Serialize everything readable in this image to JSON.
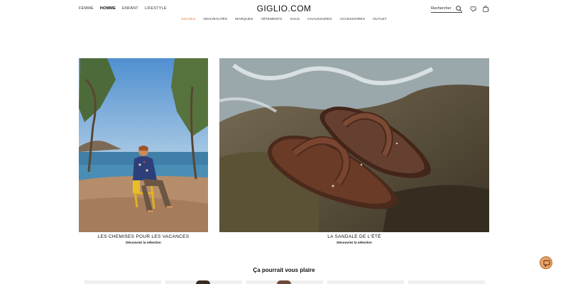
{
  "header": {
    "gender_nav": [
      {
        "label": "FEMME",
        "active": false
      },
      {
        "label": "HOMME",
        "active": true
      },
      {
        "label": "ENFANT",
        "active": false
      },
      {
        "label": "LIFESTYLE",
        "active": false
      }
    ],
    "logo": "GIGLIO.COM",
    "search_label": "Rechercher",
    "wishlist_count": "0",
    "bag_count": "0"
  },
  "category_nav": [
    {
      "label": "SOLDES",
      "highlight": true
    },
    {
      "label": "NOUVEAUTÉS",
      "highlight": false
    },
    {
      "label": "MARQUES",
      "highlight": false
    },
    {
      "label": "VÊTEMENTS",
      "highlight": false
    },
    {
      "label": "SACS",
      "highlight": false
    },
    {
      "label": "CHAUSSURES",
      "highlight": false
    },
    {
      "label": "ACCESSOIRES",
      "highlight": false
    },
    {
      "label": "OUTLET",
      "highlight": false
    }
  ],
  "hero": {
    "left": {
      "title": "LES CHEMISES POUR LES VACANCES",
      "cta": "Découvrez la sélection"
    },
    "right": {
      "title": "LA SANDALE DE L'ÉTÉ",
      "cta": "Découvrez la sélection"
    }
  },
  "recommendations": {
    "title": "Ça pourrait vous plaire"
  },
  "colors": {
    "accent_sale": "#e07a3e",
    "chat_button": "#e9a46a"
  }
}
